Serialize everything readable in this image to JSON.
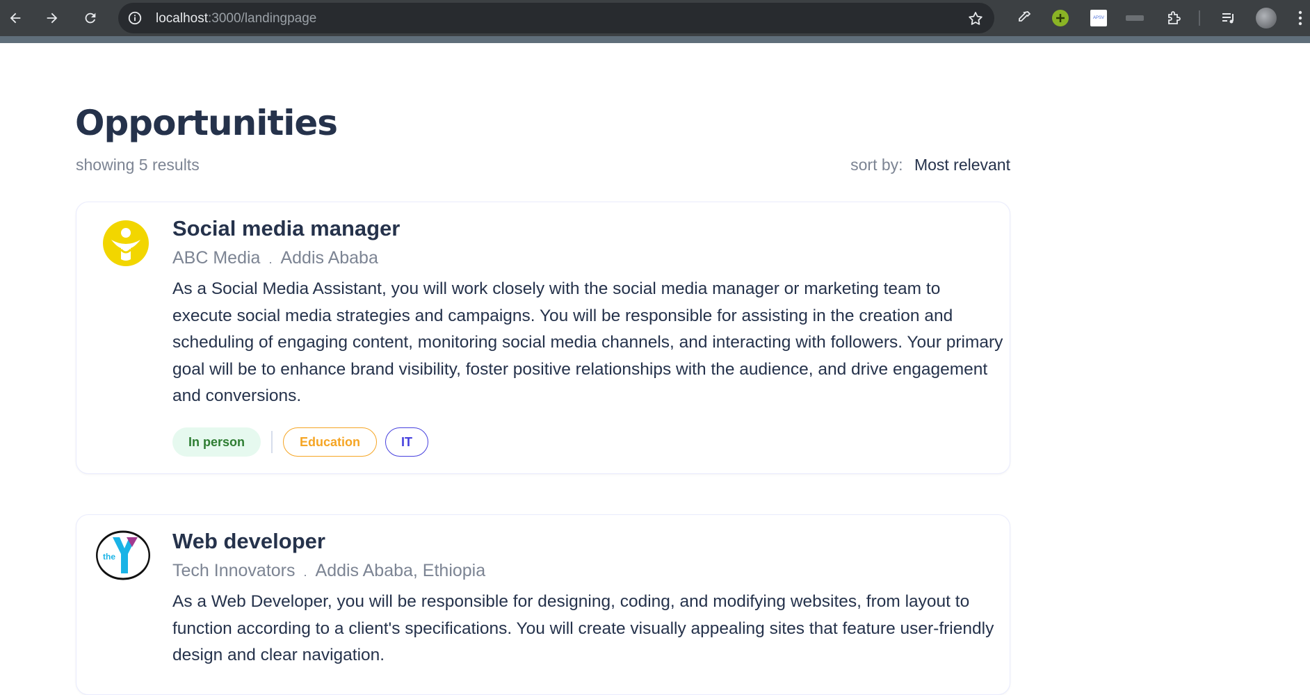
{
  "browser": {
    "url_host": "localhost",
    "url_path": ":3000/landingpage"
  },
  "page": {
    "title": "Opportunities",
    "results_text": "showing 5 results",
    "sort_label": "sort by:",
    "sort_value": "Most relevant"
  },
  "jobs": [
    {
      "title": "Social media manager",
      "company": "ABC Media",
      "separator": ".",
      "location": "Addis Ababa",
      "description": "As a Social Media Assistant, you will work closely with the social media manager or marketing team to execute social media strategies and campaigns. You will be responsible for assisting in the creation and scheduling of engaging content, monitoring social media channels, and interacting with followers. Your primary goal will be to enhance brand visibility, foster positive relationships with the audience, and drive engagement and conversions.",
      "tags": [
        "In person",
        "Education",
        "IT"
      ]
    },
    {
      "title": "Web developer",
      "company": "Tech Innovators",
      "separator": ".",
      "location": "Addis Ababa, Ethiopia",
      "description": "As a Web Developer, you will be responsible for designing, coding, and modifying websites, from layout to function according to a client's specifications. You will create visually appealing sites that feature user-friendly design and clear navigation.",
      "logo_text": "the"
    }
  ],
  "colors": {
    "heading": "#25324b",
    "muted": "#7c8493",
    "tag_inperson_bg": "#e6f9ef",
    "tag_education": "#f5a524",
    "tag_it": "#4640de"
  }
}
